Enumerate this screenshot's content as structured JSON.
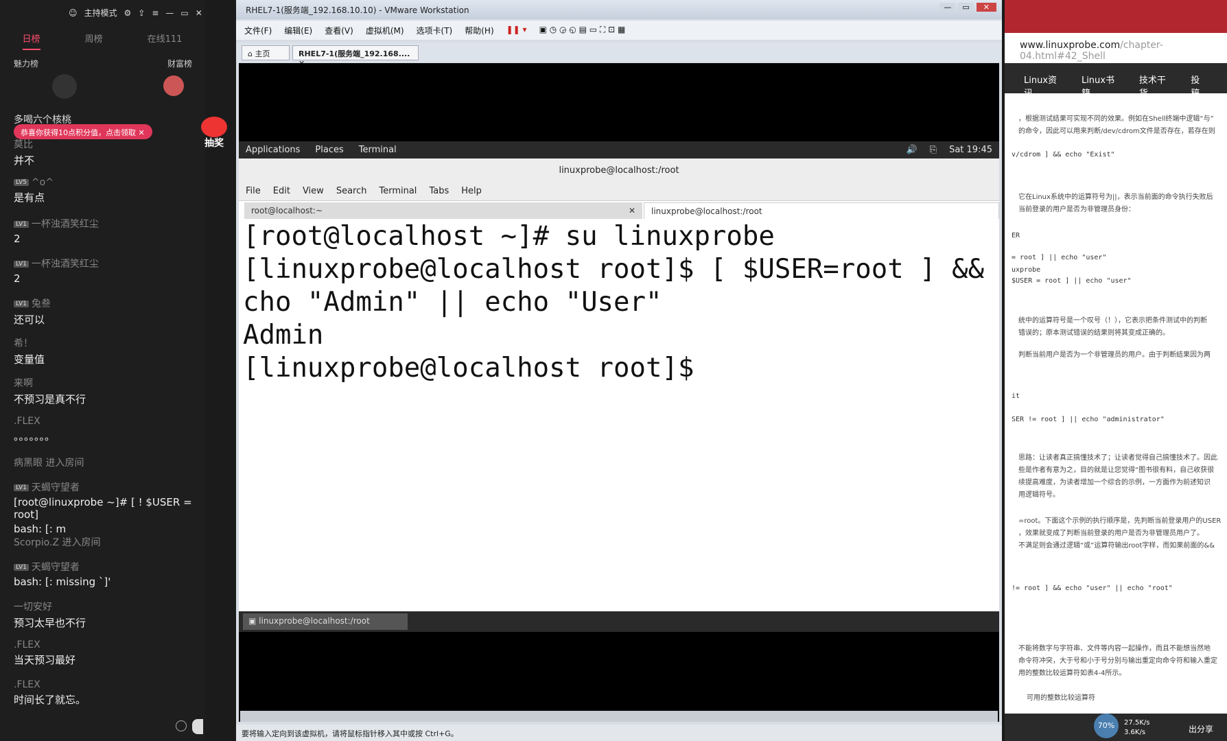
{
  "chat": {
    "header": {
      "mode": "主持模式"
    },
    "tabs": [
      "日榜",
      "周榜",
      "在线111"
    ],
    "ranks": {
      "left": "魅力榜",
      "right": "财富榜"
    },
    "toast": "恭喜你获得10点积分值，点击领取",
    "prize_label": "抽奖",
    "messages": [
      {
        "name": "多喝六个核桃",
        "lv": "",
        "text": ""
      },
      {
        "name": "莫比",
        "lv": "",
        "text": "并不"
      },
      {
        "name": "^o^",
        "lv": "LV5",
        "text": "是有点"
      },
      {
        "name": "一杯浊酒笑红尘",
        "lv": "LV1",
        "text": "2"
      },
      {
        "name": "一杯浊酒笑红尘",
        "lv": "LV1",
        "text": "2"
      },
      {
        "name": "兔叁",
        "lv": "LV1",
        "text": "还可以"
      },
      {
        "name": "希！",
        "lv": "",
        "text": "变量值"
      },
      {
        "name": "来啊",
        "lv": "",
        "text": "不预习是真不行"
      },
      {
        "name": ".FLEX",
        "lv": "",
        "text": "。。。。。。。"
      },
      {
        "name": "病黑眼 进入房间",
        "lv": "",
        "text": ""
      },
      {
        "name": "天蝎守望者",
        "lv": "LV1",
        "text": "[root@linuxprobe ~]# [ ! $USER = root]"
      },
      {
        "name": "",
        "lv": "",
        "text": "bash: [: m"
      },
      {
        "name": "Scorpio.Z 进入房间",
        "lv": "",
        "text": ""
      },
      {
        "name": "天蝎守望者",
        "lv": "LV1",
        "text": "bash: [: missing `]'"
      },
      {
        "name": "一切安好",
        "lv": "",
        "text": "预习太早也不行"
      },
      {
        "name": ".FLEX",
        "lv": "",
        "text": "当天预习最好"
      },
      {
        "name": ".FLEX",
        "lv": "",
        "text": "时间长了就忘。"
      }
    ]
  },
  "vmware": {
    "title": "RHEL7-1(服务端_192.168.10.10) - VMware Workstation",
    "menu": [
      "文件(F)",
      "编辑(E)",
      "查看(V)",
      "虚拟机(M)",
      "选项卡(T)",
      "帮助(H)"
    ],
    "tabs": [
      "主页",
      "RHEL7-1(服务端_192.168...."
    ],
    "status": "要将输入定向到该虚拟机，请将鼠标指针移入其中或按 Ctrl+G。"
  },
  "gnome": {
    "applications": "Applications",
    "places": "Places",
    "terminal": "Terminal",
    "clock": "Sat 19:45"
  },
  "terminal": {
    "title": "linuxprobe@localhost:/root",
    "menu": [
      "File",
      "Edit",
      "View",
      "Search",
      "Terminal",
      "Tabs",
      "Help"
    ],
    "tab1": "root@localhost:~",
    "tab2": "linuxprobe@localhost:/root",
    "lines": [
      "[root@localhost ~]# su linuxprobe",
      "[linuxprobe@localhost root]$ [ $USER=root ] &&",
      "cho \"Admin\" || echo \"User\"",
      "Admin",
      "[linuxprobe@localhost root]$ "
    ],
    "taskbar_item": "linuxprobe@localhost:/root"
  },
  "browser": {
    "url_host": "www.linuxprobe.com",
    "url_path": "/chapter-04.html#42_Shell",
    "nav": [
      "Linux资讯",
      "Linux书籍",
      "技术干货",
      "投稿"
    ],
    "blocks": [
      {
        "type": "text",
        "value": "，根据测试结果可实现不同的效果。例如在Shell终端中逻辑“与”"
      },
      {
        "type": "text",
        "value": "的命令，因此可以用来判断/dev/cdrom文件是否存在，若存在则"
      },
      {
        "type": "code",
        "value": "v/cdrom ] && echo \"Exist\""
      },
      {
        "type": "text",
        "value": "它在Linux系统中的运算符号为||，表示当前面的命令执行失败后"
      },
      {
        "type": "text",
        "value": "当前登录的用户是否为非管理员身份："
      },
      {
        "type": "code",
        "value": "ER"
      },
      {
        "type": "code",
        "value": "= root ] || echo \"user\""
      },
      {
        "type": "code",
        "value": "uxprobe"
      },
      {
        "type": "code",
        "value": "$USER = root ] || echo \"user\""
      },
      {
        "type": "text",
        "value": "统中的运算符号是一个叹号（！），它表示把条件测试中的判断"
      },
      {
        "type": "text",
        "value": "错误的；原本测试错误的结果则将其变成正确的。"
      },
      {
        "type": "text",
        "value": "判断当前用户是否为一个非管理员的用户。由于判断结果因为两"
      },
      {
        "type": "code",
        "value": "it"
      },
      {
        "type": "code",
        "value": "SER != root ] || echo \"administrator\""
      },
      {
        "type": "text",
        "value": "思路：让读者真正搞懂技术了；让读者觉得自己搞懂技术了。因此"
      },
      {
        "type": "text",
        "value": "些是作者有意为之，目的就是让您觉得“图书很有料，自己收获很"
      },
      {
        "type": "text",
        "value": "续提高难度，为读者增加一个综合的示例，一方面作为前述知识"
      },
      {
        "type": "text",
        "value": "用逻辑符号。"
      },
      {
        "type": "text",
        "value": "=root。下面这个示例的执行顺序是，先判断当前登录用户的USER"
      },
      {
        "type": "text",
        "value": "，效果就变成了判断当前登录的用户是否为非管理员用户了。"
      },
      {
        "type": "text",
        "value": "不满足则会通过逻辑“或”运算符输出root字样，而如果前面的&&"
      },
      {
        "type": "code",
        "value": "!= root ] && echo \"user\" || echo \"root\""
      },
      {
        "type": "text",
        "value": "不能将数字与字符串、文件等内容一起操作，而且不能想当然地"
      },
      {
        "type": "text",
        "value": "命令符冲突，大于号和小于号分别与输出重定向命令符和输入重定"
      },
      {
        "type": "text",
        "value": "用的整数比较运算符如表4-4所示。"
      },
      {
        "type": "text",
        "value": "可用的整数比较运算符"
      }
    ],
    "cpu": "70%",
    "net_up": "27.5K/s",
    "net_down": "3.6K/s",
    "share": "出分享"
  }
}
